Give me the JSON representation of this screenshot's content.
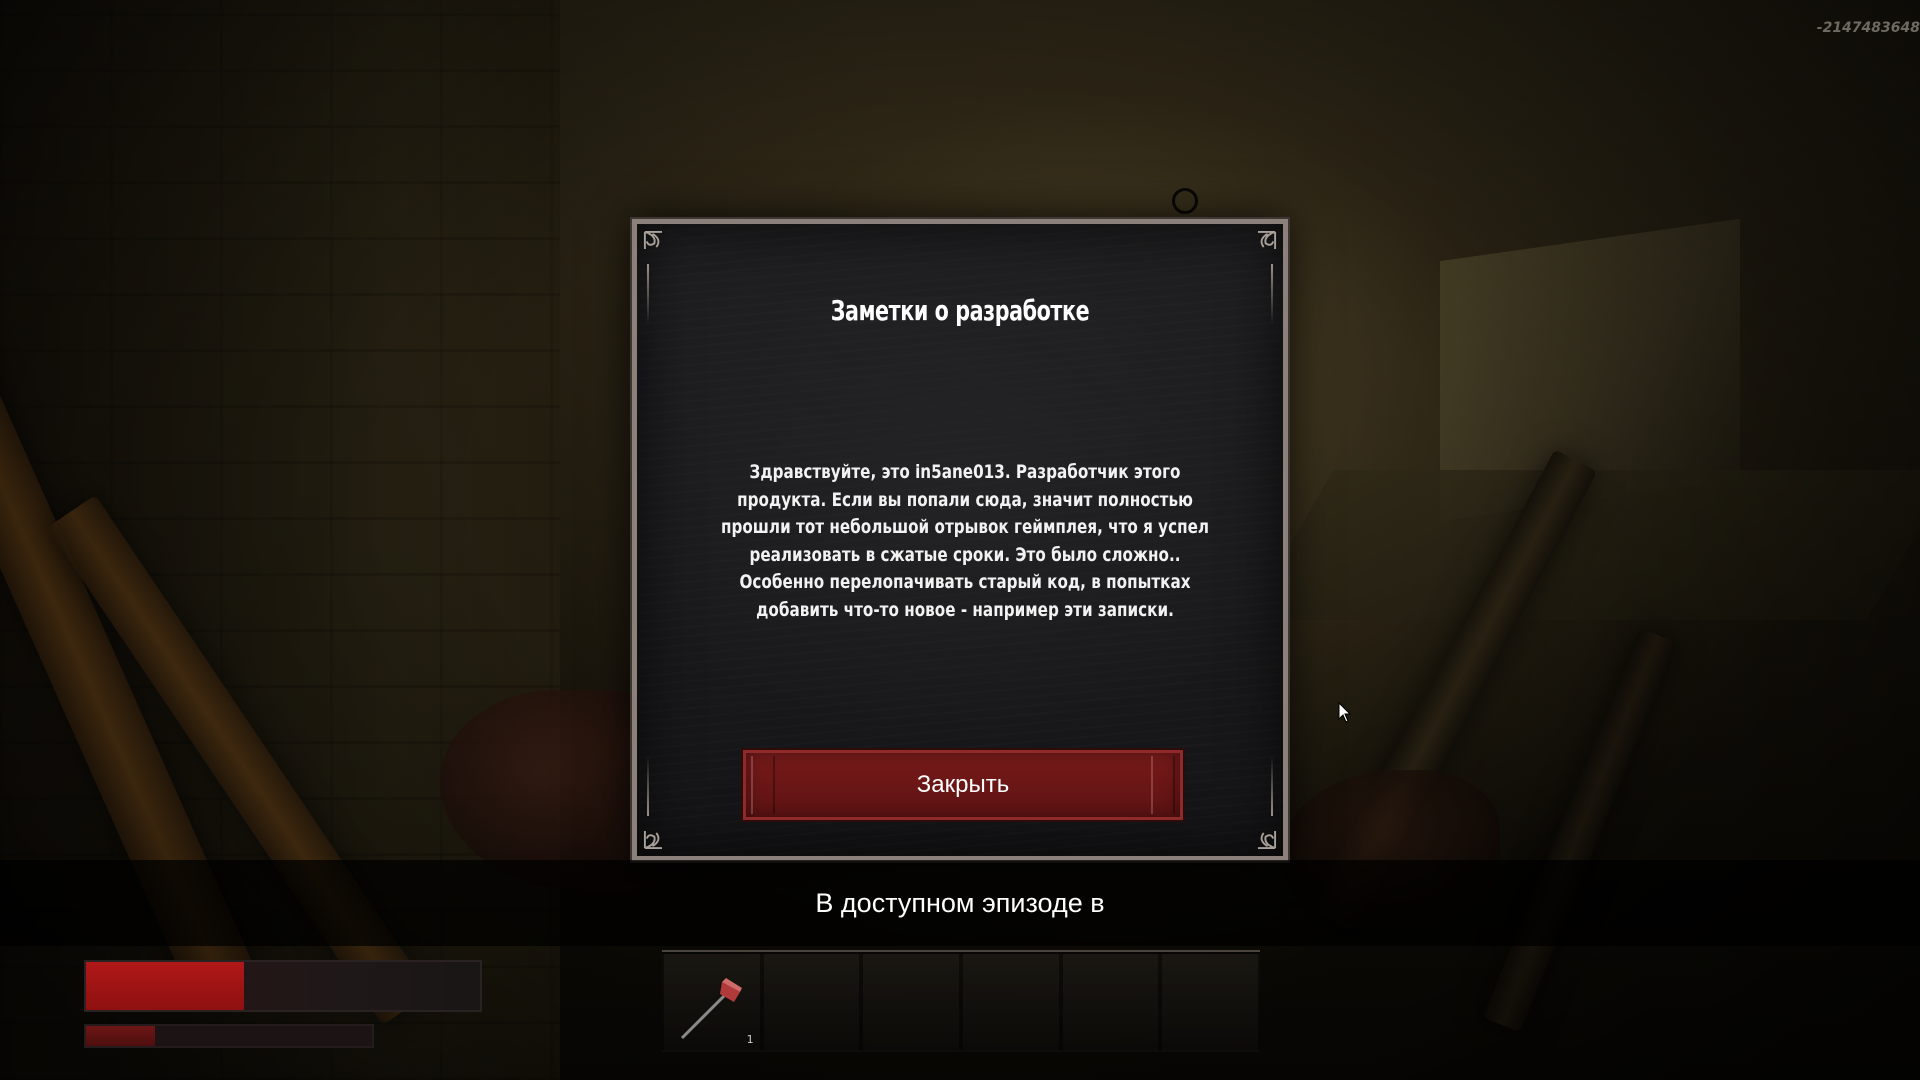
{
  "debug": {
    "id_text": "-2147483648"
  },
  "modal": {
    "title": "Заметки о разработке",
    "body": "Здравствуйте, это in5ane013. Разработчик этого продукта. Если вы попали сюда, значит полностью прошли тот небольшой отрывок геймплея, что я успел реализовать в сжатые сроки. Это было сложно.. Особенно перелопачивать старый код, в попытках добавить что-то новое - например эти записки.",
    "close_label": "Закрыть"
  },
  "subtitle": {
    "text": "В доступном эпизоде в"
  },
  "hud": {
    "health_fraction": 0.4,
    "stamina_fraction": 0.24,
    "hotbar": {
      "slots": [
        {
          "item_icon": "axe-icon",
          "count": "1"
        },
        {
          "item_icon": "",
          "count": ""
        },
        {
          "item_icon": "",
          "count": ""
        },
        {
          "item_icon": "",
          "count": ""
        },
        {
          "item_icon": "",
          "count": ""
        },
        {
          "item_icon": "",
          "count": ""
        }
      ]
    }
  },
  "colors": {
    "button_red": "#6e1717",
    "health_red": "#b01818",
    "modal_bg": "#1a1a1c",
    "frame": "#8c817a"
  }
}
